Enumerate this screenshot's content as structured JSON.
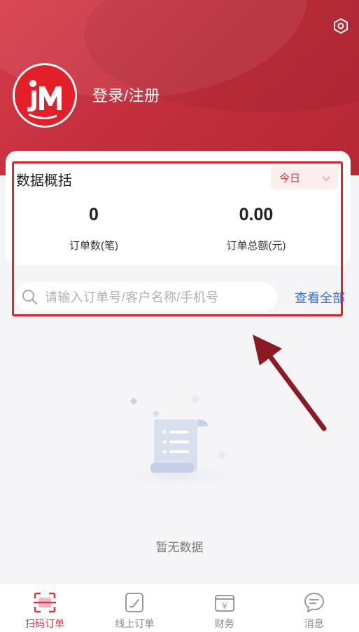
{
  "header": {
    "login_label": "登录/注册",
    "settings_icon": "settings-hexagon-icon",
    "avatar_logo": "jm-logo"
  },
  "overview": {
    "title": "数据概括",
    "period": {
      "selected": "今日",
      "icon": "chevron-down-icon"
    },
    "stats": [
      {
        "value": "0",
        "label": "订单数(笔)"
      },
      {
        "value": "0.00",
        "label": "订单总额(元)"
      }
    ]
  },
  "search": {
    "placeholder": "请输入订单号/客户名称/手机号",
    "view_all": "查看全部"
  },
  "empty_state": {
    "text": "暂无数据"
  },
  "tabbar": {
    "items": [
      {
        "label": "扫码订单",
        "icon": "scan-order-icon",
        "active": true
      },
      {
        "label": "线上订单",
        "icon": "edit-note-icon",
        "active": false
      },
      {
        "label": "财务",
        "icon": "yen-wallet-icon",
        "active": false
      },
      {
        "label": "消息",
        "icon": "chat-bubble-icon",
        "active": false
      }
    ]
  },
  "colors": {
    "brand_red": "#c42f3d",
    "accent_red": "#d23a45",
    "link_blue": "#3d6fc7",
    "annotation_red": "#e0242f",
    "annotation_arrow": "#8b1a22"
  }
}
